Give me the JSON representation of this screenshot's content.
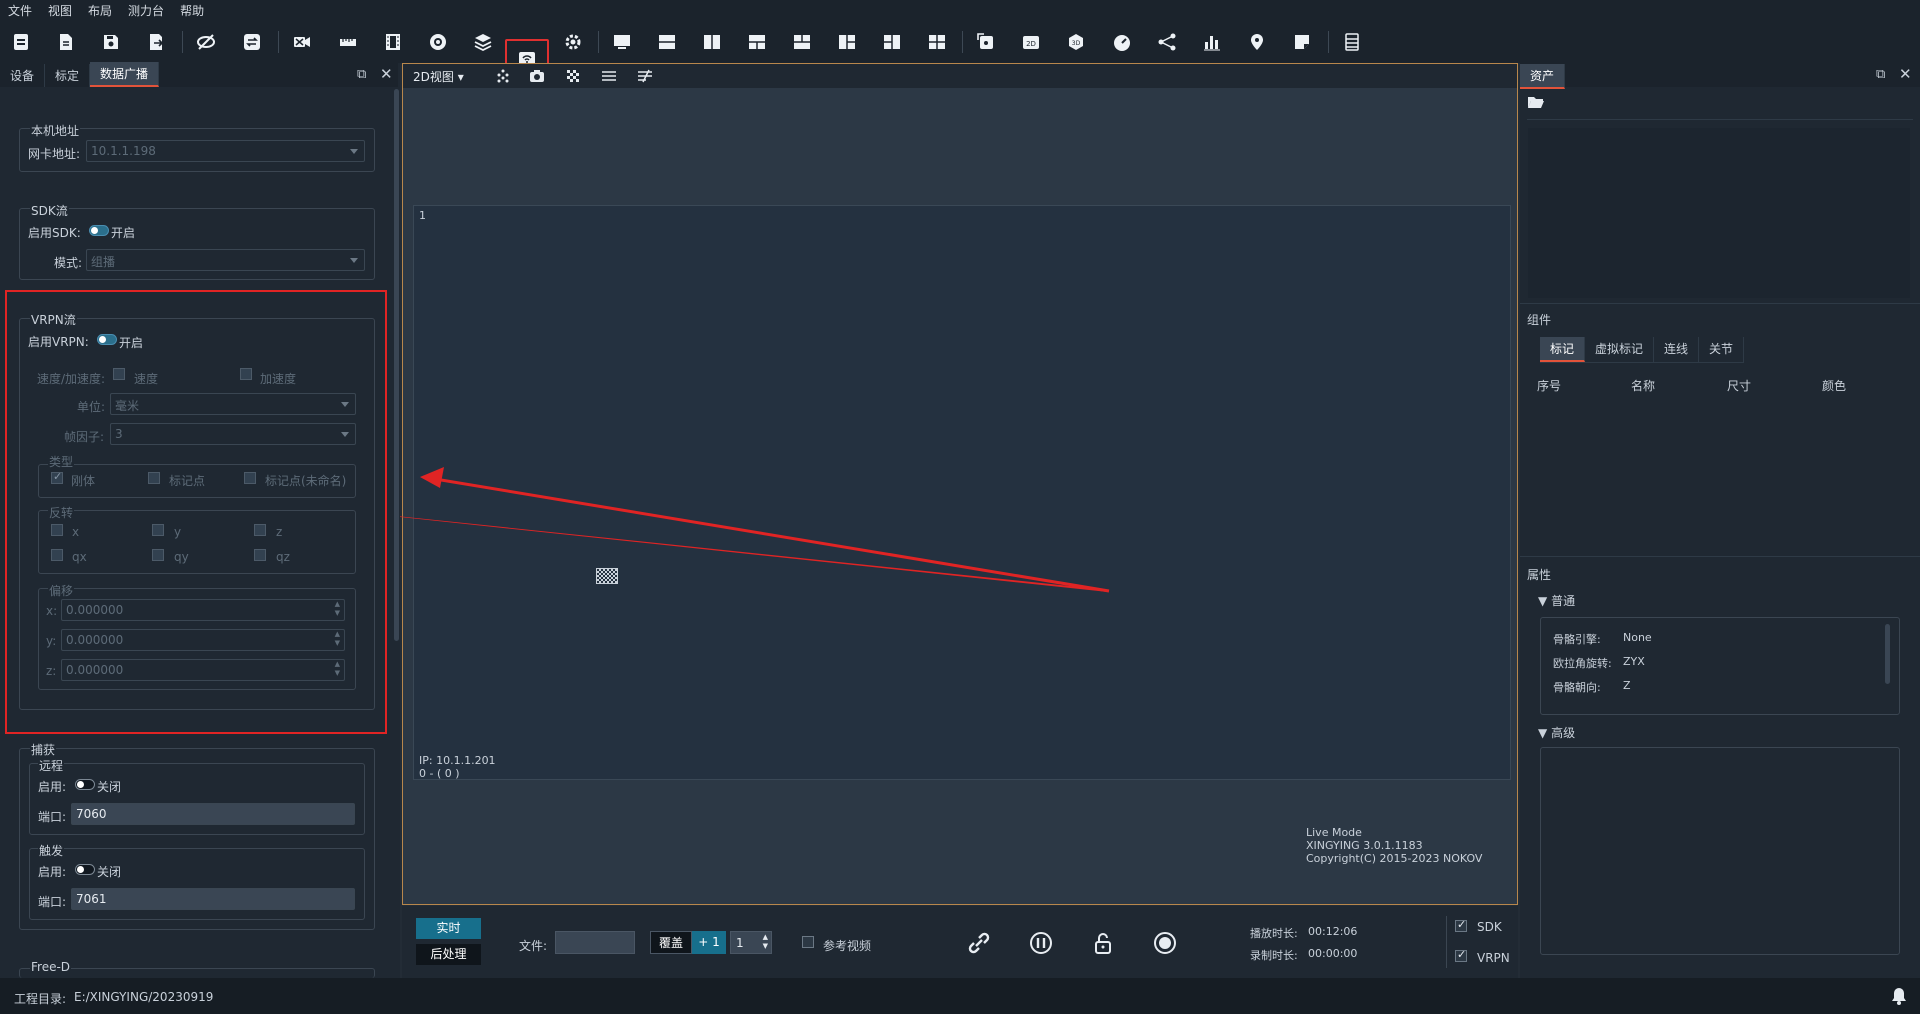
{
  "menu": [
    "文件",
    "视图",
    "布局",
    "测力台",
    "帮助"
  ],
  "toolbar_icons": [
    "open-project-icon",
    "new-file-icon",
    "save-icon",
    "export-icon",
    "hide-icon",
    "refresh-icon",
    "video-off-icon",
    "ruler-icon",
    "film-icon",
    "record-circle-icon",
    "layers-icon",
    "broadcast-icon",
    "settings-gear-icon",
    "layout-single-icon",
    "layout-horizontal-icon",
    "layout-vertical-icon",
    "layout-grid-a-icon",
    "layout-grid-b-icon",
    "layout-grid-c-icon",
    "layout-grid-d-icon",
    "layout-quad-icon",
    "frame-export-icon",
    "camera-2d-icon",
    "view-3d-icon",
    "speedometer-icon",
    "graph-nodes-icon",
    "bar-chart-icon",
    "location-pin-icon",
    "note-icon",
    "server-icon"
  ],
  "left_panel": {
    "tabs": [
      "设备",
      "标定",
      "数据广播"
    ],
    "active_tab": "数据广播",
    "local": {
      "title": "本机地址",
      "nic_label": "网卡地址:",
      "nic_value": "10.1.1.198"
    },
    "sdk": {
      "title": "SDK流",
      "enable_label": "启用SDK:",
      "enable_text": "开启",
      "mode_label": "模式:",
      "mode_value": "组播"
    },
    "vrpn": {
      "title": "VRPN流",
      "enable_label": "启用VRPN:",
      "enable_text": "开启",
      "speed_label": "速度/加速度:",
      "speed_opt": "速度",
      "accel_opt": "加速度",
      "unit_label": "单位:",
      "unit_value": "毫米",
      "frame_factor_label": "帧因子:",
      "frame_factor_value": "3",
      "type_title": "类型",
      "type_opts": [
        "刚体",
        "标记点",
        "标记点(未命名)"
      ],
      "flip_title": "反转",
      "flip_opts": [
        "x",
        "y",
        "z",
        "qx",
        "qy",
        "qz"
      ],
      "offset_title": "偏移",
      "offset_rows": [
        {
          "label": "x:",
          "value": "0.000000"
        },
        {
          "label": "y:",
          "value": "0.000000"
        },
        {
          "label": "z:",
          "value": "0.000000"
        }
      ]
    },
    "capture": {
      "title": "捕获",
      "remote_title": "远程",
      "remote_enable_label": "启用:",
      "remote_enable_text": "关闭",
      "remote_port_label": "端口:",
      "remote_port_value": "7060",
      "trigger_title": "触发",
      "trigger_enable_label": "启用:",
      "trigger_enable_text": "关闭",
      "trigger_port_label": "端口:",
      "trigger_port_value": "7061"
    },
    "freed_title": "Free-D"
  },
  "view": {
    "mode_label": "2D视图",
    "camera_index": "1",
    "ip_text": "IP: 10.1.1.201",
    "frame_text": "0 - ( 0 )",
    "info_lines": [
      "Live Mode",
      "XINGYING 3.0.1.1183",
      "Copyright(C) 2015-2023 NOKOV"
    ]
  },
  "bottom": {
    "realtime_label": "实时",
    "postproc_label": "后处理",
    "file_label": "文件:",
    "overlay_label": "覆盖",
    "plus_label": "+ 1",
    "spin_value": "1",
    "ref_video_label": "参考视频",
    "play_duration_label": "播放时长:",
    "play_duration_value": "00:12:06",
    "record_duration_label": "录制时长:",
    "record_duration_value": "00:00:00",
    "sdk_label": "SDK",
    "vrpn_label": "VRPN"
  },
  "right_panel": {
    "tab": "资产",
    "components_title": "组件",
    "comp_tabs": [
      "标记",
      "虚拟标记",
      "连线",
      "关节"
    ],
    "table_headers": [
      "序号",
      "名称",
      "尺寸",
      "颜色"
    ],
    "properties_title": "属性",
    "general_title": "普通",
    "props": [
      {
        "key": "骨骼引擎:",
        "value": "None"
      },
      {
        "key": "欧拉角旋转:",
        "value": "ZYX"
      },
      {
        "key": "骨骼朝向:",
        "value": "Z"
      }
    ],
    "advanced_title": "高级"
  },
  "status": {
    "project_label": "工程目录:",
    "project_path": "E:/XINGYING/20230919"
  },
  "colors": {
    "accent_red": "#e02424",
    "accent_blue": "#176f8c",
    "frame_orange": "#b8874c"
  }
}
